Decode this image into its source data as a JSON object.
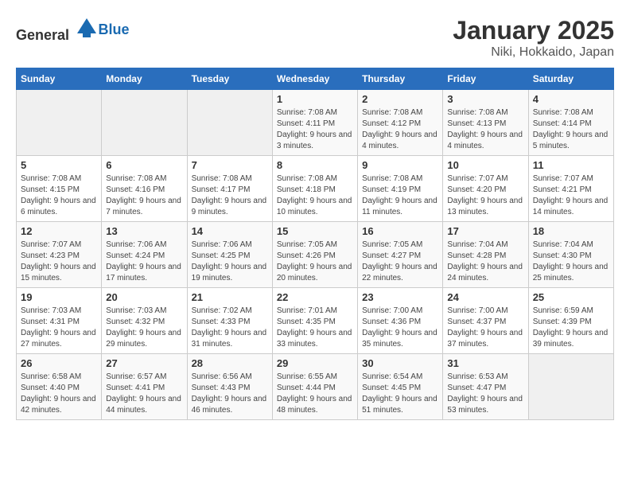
{
  "header": {
    "logo_general": "General",
    "logo_blue": "Blue",
    "title": "January 2025",
    "subtitle": "Niki, Hokkaido, Japan"
  },
  "weekdays": [
    "Sunday",
    "Monday",
    "Tuesday",
    "Wednesday",
    "Thursday",
    "Friday",
    "Saturday"
  ],
  "weeks": [
    [
      {
        "day": "",
        "info": ""
      },
      {
        "day": "",
        "info": ""
      },
      {
        "day": "",
        "info": ""
      },
      {
        "day": "1",
        "info": "Sunrise: 7:08 AM\nSunset: 4:11 PM\nDaylight: 9 hours and 3 minutes."
      },
      {
        "day": "2",
        "info": "Sunrise: 7:08 AM\nSunset: 4:12 PM\nDaylight: 9 hours and 4 minutes."
      },
      {
        "day": "3",
        "info": "Sunrise: 7:08 AM\nSunset: 4:13 PM\nDaylight: 9 hours and 4 minutes."
      },
      {
        "day": "4",
        "info": "Sunrise: 7:08 AM\nSunset: 4:14 PM\nDaylight: 9 hours and 5 minutes."
      }
    ],
    [
      {
        "day": "5",
        "info": "Sunrise: 7:08 AM\nSunset: 4:15 PM\nDaylight: 9 hours and 6 minutes."
      },
      {
        "day": "6",
        "info": "Sunrise: 7:08 AM\nSunset: 4:16 PM\nDaylight: 9 hours and 7 minutes."
      },
      {
        "day": "7",
        "info": "Sunrise: 7:08 AM\nSunset: 4:17 PM\nDaylight: 9 hours and 9 minutes."
      },
      {
        "day": "8",
        "info": "Sunrise: 7:08 AM\nSunset: 4:18 PM\nDaylight: 9 hours and 10 minutes."
      },
      {
        "day": "9",
        "info": "Sunrise: 7:08 AM\nSunset: 4:19 PM\nDaylight: 9 hours and 11 minutes."
      },
      {
        "day": "10",
        "info": "Sunrise: 7:07 AM\nSunset: 4:20 PM\nDaylight: 9 hours and 13 minutes."
      },
      {
        "day": "11",
        "info": "Sunrise: 7:07 AM\nSunset: 4:21 PM\nDaylight: 9 hours and 14 minutes."
      }
    ],
    [
      {
        "day": "12",
        "info": "Sunrise: 7:07 AM\nSunset: 4:23 PM\nDaylight: 9 hours and 15 minutes."
      },
      {
        "day": "13",
        "info": "Sunrise: 7:06 AM\nSunset: 4:24 PM\nDaylight: 9 hours and 17 minutes."
      },
      {
        "day": "14",
        "info": "Sunrise: 7:06 AM\nSunset: 4:25 PM\nDaylight: 9 hours and 19 minutes."
      },
      {
        "day": "15",
        "info": "Sunrise: 7:05 AM\nSunset: 4:26 PM\nDaylight: 9 hours and 20 minutes."
      },
      {
        "day": "16",
        "info": "Sunrise: 7:05 AM\nSunset: 4:27 PM\nDaylight: 9 hours and 22 minutes."
      },
      {
        "day": "17",
        "info": "Sunrise: 7:04 AM\nSunset: 4:28 PM\nDaylight: 9 hours and 24 minutes."
      },
      {
        "day": "18",
        "info": "Sunrise: 7:04 AM\nSunset: 4:30 PM\nDaylight: 9 hours and 25 minutes."
      }
    ],
    [
      {
        "day": "19",
        "info": "Sunrise: 7:03 AM\nSunset: 4:31 PM\nDaylight: 9 hours and 27 minutes."
      },
      {
        "day": "20",
        "info": "Sunrise: 7:03 AM\nSunset: 4:32 PM\nDaylight: 9 hours and 29 minutes."
      },
      {
        "day": "21",
        "info": "Sunrise: 7:02 AM\nSunset: 4:33 PM\nDaylight: 9 hours and 31 minutes."
      },
      {
        "day": "22",
        "info": "Sunrise: 7:01 AM\nSunset: 4:35 PM\nDaylight: 9 hours and 33 minutes."
      },
      {
        "day": "23",
        "info": "Sunrise: 7:00 AM\nSunset: 4:36 PM\nDaylight: 9 hours and 35 minutes."
      },
      {
        "day": "24",
        "info": "Sunrise: 7:00 AM\nSunset: 4:37 PM\nDaylight: 9 hours and 37 minutes."
      },
      {
        "day": "25",
        "info": "Sunrise: 6:59 AM\nSunset: 4:39 PM\nDaylight: 9 hours and 39 minutes."
      }
    ],
    [
      {
        "day": "26",
        "info": "Sunrise: 6:58 AM\nSunset: 4:40 PM\nDaylight: 9 hours and 42 minutes."
      },
      {
        "day": "27",
        "info": "Sunrise: 6:57 AM\nSunset: 4:41 PM\nDaylight: 9 hours and 44 minutes."
      },
      {
        "day": "28",
        "info": "Sunrise: 6:56 AM\nSunset: 4:43 PM\nDaylight: 9 hours and 46 minutes."
      },
      {
        "day": "29",
        "info": "Sunrise: 6:55 AM\nSunset: 4:44 PM\nDaylight: 9 hours and 48 minutes."
      },
      {
        "day": "30",
        "info": "Sunrise: 6:54 AM\nSunset: 4:45 PM\nDaylight: 9 hours and 51 minutes."
      },
      {
        "day": "31",
        "info": "Sunrise: 6:53 AM\nSunset: 4:47 PM\nDaylight: 9 hours and 53 minutes."
      },
      {
        "day": "",
        "info": ""
      }
    ]
  ]
}
